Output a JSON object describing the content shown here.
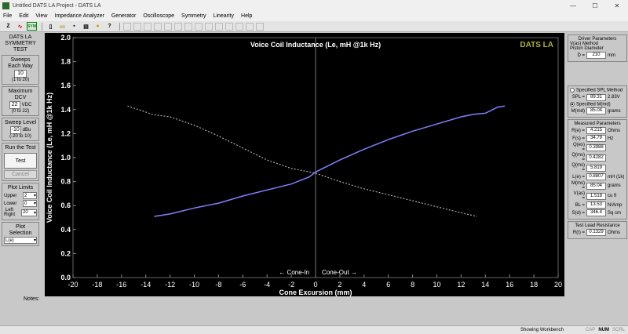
{
  "window": {
    "title": "Untitled DATS LA Project - DATS LA"
  },
  "menu": [
    "File",
    "Edit",
    "View",
    "Impedance Analyzer",
    "Generator",
    "Oscilloscope",
    "Symmetry",
    "Linearity",
    "Help"
  ],
  "left": {
    "title1": "DATS LA",
    "title2": "SYMMETRY",
    "title3": "TEST",
    "sweeps_label": "Sweeps Each Way",
    "sweeps_value": "10",
    "sweeps_range": "(1 to 20)",
    "dcv_label": "Maximum DCV",
    "dcv_value": "22",
    "dcv_unit": "VDC",
    "dcv_range": "(0 to 22)",
    "sweep_level_label": "Sweep Level",
    "sweep_level_value": "-10",
    "sweep_level_unit": "dBu",
    "sweep_level_range": "(-20 to 10)",
    "run_label": "Run the Test",
    "test_btn": "Test",
    "cancel_btn": "Cancel",
    "plot_limits_label": "Plot Limits",
    "upper_label": "Upper",
    "upper_value": "2",
    "lower_label": "Lower",
    "lower_value": "0",
    "leftright_label1": "Left",
    "leftright_label2": "Right",
    "leftright_value": "20",
    "plot_sel_label": "Plot Selection",
    "plot_sel_value": "L(e)"
  },
  "right": {
    "driver_params": "Driver Parameters",
    "vas_method": "V(as) Method",
    "piston": "Piston Diameter",
    "d_label": "D =",
    "d_value": "210",
    "d_unit": "mm",
    "spl_method": "Specified SPL Method",
    "spl_label": "SPL =",
    "spl_value": "89.31",
    "spl_unit": "2.83V",
    "mmd_method": "Specified M(md)",
    "mmd_label": "M(md)",
    "mmd_value": "85.04",
    "mmd_unit": "grams",
    "measured": "Measured Parameters",
    "params": [
      {
        "label": "R(e) =",
        "value": "4.215",
        "unit": "Ohms"
      },
      {
        "label": "F(s) =",
        "value": "34.79",
        "unit": "Hz"
      },
      {
        "label": "Q(es) =",
        "value": "0.3988",
        "unit": ""
      },
      {
        "label": "Q(ms) =",
        "value": "0.4282",
        "unit": ""
      },
      {
        "label": "Q(ms) =",
        "value": "5.819",
        "unit": ""
      },
      {
        "label": "L(e) =",
        "value": "0.8807",
        "unit": "mH (1k)"
      },
      {
        "label": "M(ms) =",
        "value": "85.04",
        "unit": "grams"
      },
      {
        "label": "V(as) =",
        "value": "1.518",
        "unit": "cu ft"
      },
      {
        "label": "BL =",
        "value": "13.53",
        "unit": "N/Amp"
      },
      {
        "label": "S(d) =",
        "value": "346.4",
        "unit": "Sq cm"
      }
    ],
    "lead": "Test Lead Resistance",
    "lead_label": "R(t) =",
    "lead_value": "0.1329",
    "lead_unit": "Ohms"
  },
  "notes_label": "Notes:",
  "status": {
    "text": "Showing Workbench",
    "cap": "CAP",
    "num": "NUM",
    "scrl": "SCRL"
  },
  "chart_data": {
    "type": "line",
    "title": "Voice Coil Inductance (Le, mH @1k Hz)",
    "xlabel": "Cone Excursion (mm)",
    "ylabel": "Voice Coil Inductance (Le, mH @1k Hz)",
    "watermark": "DATS LA",
    "cone_in": "← Cone-In",
    "cone_out": "Cone-Out →",
    "xlim": [
      -20,
      20
    ],
    "ylim": [
      0,
      2
    ],
    "xticks": [
      -20,
      -18,
      -16,
      -14,
      -12,
      -10,
      -8,
      -6,
      -4,
      -2,
      0,
      2,
      4,
      6,
      8,
      10,
      12,
      14,
      16,
      18,
      20
    ],
    "yticks": [
      "0.0",
      "0.2",
      "0.4",
      "0.6",
      "0.8",
      "1.0",
      "1.2",
      "1.4",
      "1.6",
      "1.8",
      "2.0"
    ],
    "colors": {
      "solid": "#8080ff",
      "dotted": "#aaaaaa"
    },
    "series": [
      {
        "style": "solid",
        "x": [
          -13.3,
          -12,
          -10,
          -9,
          -8,
          -7,
          -6,
          -4,
          -2,
          -0.5,
          0,
          2,
          4,
          6,
          8,
          10,
          12,
          13,
          14,
          14.6,
          15,
          15.6
        ],
        "y": [
          0.51,
          0.53,
          0.58,
          0.6,
          0.62,
          0.65,
          0.68,
          0.73,
          0.78,
          0.84,
          0.88,
          0.98,
          1.07,
          1.15,
          1.22,
          1.28,
          1.34,
          1.36,
          1.37,
          1.4,
          1.42,
          1.43
        ]
      },
      {
        "style": "dotted",
        "x": [
          -15.5,
          -14,
          -13.5,
          -12,
          -10,
          -8,
          -6,
          -4,
          -2,
          0,
          2,
          4,
          6,
          8,
          10,
          12,
          13.3
        ],
        "y": [
          1.43,
          1.38,
          1.36,
          1.34,
          1.27,
          1.18,
          1.08,
          0.98,
          0.91,
          0.87,
          0.8,
          0.74,
          0.69,
          0.64,
          0.59,
          0.54,
          0.51
        ]
      }
    ]
  }
}
